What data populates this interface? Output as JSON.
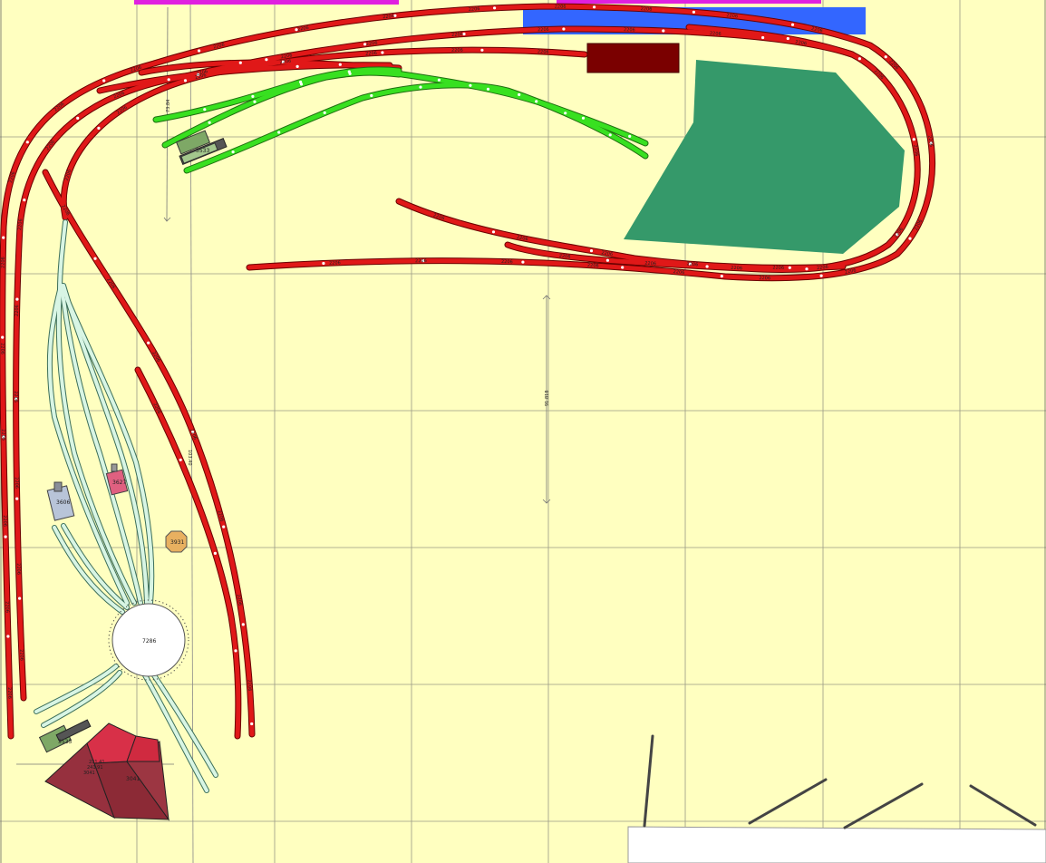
{
  "colors": {
    "background": "#ffffc0",
    "grid": "#9a9a86",
    "main_track": "#e01818",
    "sidings_track": "#38e020",
    "yard_track": "#d8f5e4",
    "hill_area": "#35996a",
    "water_area": "#3366ff",
    "magenta_strip": "#e020e0",
    "shed_block": "#7a0000",
    "roundhouse": "#96303e",
    "white_area": "#ffffff"
  },
  "dimensions": {
    "vertical_left": "73.84",
    "vertical_center": "91.818",
    "vertical_right": "103.40"
  },
  "buildings": [
    {
      "name": "building-3533",
      "label": "3533"
    },
    {
      "name": "building-3606",
      "label": "3606"
    },
    {
      "name": "building-3627",
      "label": "3627"
    },
    {
      "name": "building-3931",
      "label": "3931"
    },
    {
      "name": "building-3535",
      "label": "3535"
    },
    {
      "name": "roundhouse-3041",
      "label": "3041"
    }
  ],
  "turntable": {
    "label": "7286"
  },
  "roundhouse_dims": [
    "231.41",
    "241.91",
    "3041"
  ],
  "track_labels": [
    {
      "id": "t1",
      "text": "2206"
    },
    {
      "id": "t2",
      "text": "2206"
    },
    {
      "id": "t3",
      "text": "2206"
    },
    {
      "id": "t4",
      "text": "2206"
    },
    {
      "id": "t5",
      "text": "2206"
    },
    {
      "id": "t6",
      "text": "2206"
    },
    {
      "id": "t7",
      "text": "2206"
    },
    {
      "id": "t8",
      "text": "2206"
    },
    {
      "id": "t9",
      "text": "2206"
    },
    {
      "id": "t10",
      "text": "2206"
    },
    {
      "id": "t11",
      "text": "2206"
    },
    {
      "id": "t12",
      "text": "2206"
    },
    {
      "id": "t13",
      "text": "2206"
    },
    {
      "id": "t14",
      "text": "2206"
    },
    {
      "id": "t15",
      "text": "2206"
    },
    {
      "id": "t16",
      "text": "2206"
    },
    {
      "id": "t17",
      "text": "2206"
    },
    {
      "id": "t18",
      "text": "2206"
    },
    {
      "id": "t19",
      "text": "2206"
    },
    {
      "id": "t20",
      "text": "2206"
    },
    {
      "id": "t21",
      "text": "2206"
    },
    {
      "id": "t22",
      "text": "2206"
    },
    {
      "id": "t23",
      "text": "2206"
    },
    {
      "id": "t24",
      "text": "2206"
    },
    {
      "id": "t25",
      "text": "2206"
    },
    {
      "id": "t26",
      "text": "2206"
    },
    {
      "id": "t27",
      "text": "2206"
    },
    {
      "id": "t28",
      "text": "2206"
    },
    {
      "id": "t29",
      "text": "2206"
    },
    {
      "id": "t30",
      "text": "2206"
    },
    {
      "id": "t31",
      "text": "2206"
    },
    {
      "id": "t32",
      "text": "2206"
    },
    {
      "id": "t33",
      "text": "2206"
    },
    {
      "id": "t34",
      "text": "2206"
    },
    {
      "id": "t35",
      "text": "2206"
    },
    {
      "id": "t36",
      "text": "2206"
    },
    {
      "id": "t37",
      "text": "2206"
    },
    {
      "id": "t38",
      "text": "2206"
    },
    {
      "id": "t39",
      "text": "2206"
    },
    {
      "id": "t40",
      "text": "2206"
    },
    {
      "id": "t41",
      "text": "2206"
    },
    {
      "id": "t42",
      "text": "2206"
    },
    {
      "id": "t43",
      "text": "2206"
    },
    {
      "id": "t44",
      "text": "2206"
    },
    {
      "id": "t45",
      "text": "2206"
    },
    {
      "id": "t46",
      "text": "2206"
    },
    {
      "id": "t47",
      "text": "2206"
    },
    {
      "id": "t48",
      "text": "2206"
    },
    {
      "id": "t49",
      "text": "2206"
    },
    {
      "id": "t50",
      "text": "2206"
    },
    {
      "id": "t51",
      "text": "2206"
    },
    {
      "id": "t52",
      "text": "2206"
    },
    {
      "id": "t53",
      "text": "2206"
    },
    {
      "id": "t54",
      "text": "2206"
    },
    {
      "id": "t55",
      "text": "2206"
    },
    {
      "id": "t56",
      "text": "2206"
    },
    {
      "id": "t57",
      "text": "2206"
    },
    {
      "id": "t58",
      "text": "2206"
    },
    {
      "id": "t59",
      "text": "2206"
    },
    {
      "id": "t60",
      "text": "2206"
    },
    {
      "id": "t61",
      "text": "2206"
    },
    {
      "id": "t62",
      "text": "2206"
    },
    {
      "id": "t63",
      "text": "2206"
    },
    {
      "id": "t64",
      "text": "2206"
    },
    {
      "id": "t65",
      "text": "2206"
    },
    {
      "id": "t66",
      "text": "2206"
    },
    {
      "id": "t67",
      "text": "2206"
    },
    {
      "id": "t68",
      "text": "2206"
    },
    {
      "id": "t69",
      "text": "2206"
    },
    {
      "id": "t70",
      "text": "2206"
    }
  ]
}
